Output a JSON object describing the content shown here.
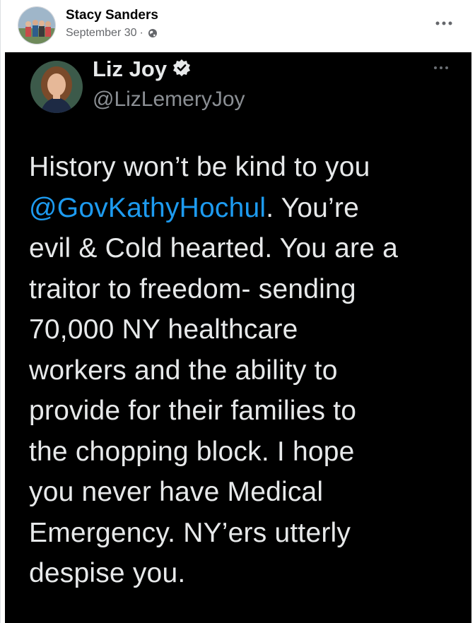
{
  "post": {
    "author": "Stacy Sanders",
    "date": "September 30",
    "separator": "·",
    "privacy_icon": "globe-icon",
    "more_icon": "more-options-icon"
  },
  "tweet": {
    "name": "Liz Joy",
    "verified_icon": "verified-badge-icon",
    "handle": "@LizLemeryJoy",
    "more_icon": "more-options-icon",
    "lines": [
      {
        "pre": "History won’t be kind to you",
        "mention": "",
        "post": ""
      },
      {
        "pre": "",
        "mention": "@GovKathyHochul",
        "post": ". You’re"
      },
      {
        "pre": "evil & Cold hearted. You are a",
        "mention": "",
        "post": ""
      },
      {
        "pre": "traitor to freedom- sending",
        "mention": "",
        "post": ""
      },
      {
        "pre": "70,000 NY healthcare",
        "mention": "",
        "post": ""
      },
      {
        "pre": "workers and the ability to",
        "mention": "",
        "post": ""
      },
      {
        "pre": "provide for their families to",
        "mention": "",
        "post": ""
      },
      {
        "pre": "the chopping block. I hope",
        "mention": "",
        "post": ""
      },
      {
        "pre": "you never have Medical",
        "mention": "",
        "post": ""
      },
      {
        "pre": "Emergency. NY’ers utterly",
        "mention": "",
        "post": ""
      },
      {
        "pre": "despise you.",
        "mention": "",
        "post": ""
      }
    ]
  },
  "colors": {
    "mention": "#1d9bf0",
    "tweet_bg": "#000000",
    "tweet_text": "#e7e9ea",
    "handle": "#8b8f94"
  }
}
